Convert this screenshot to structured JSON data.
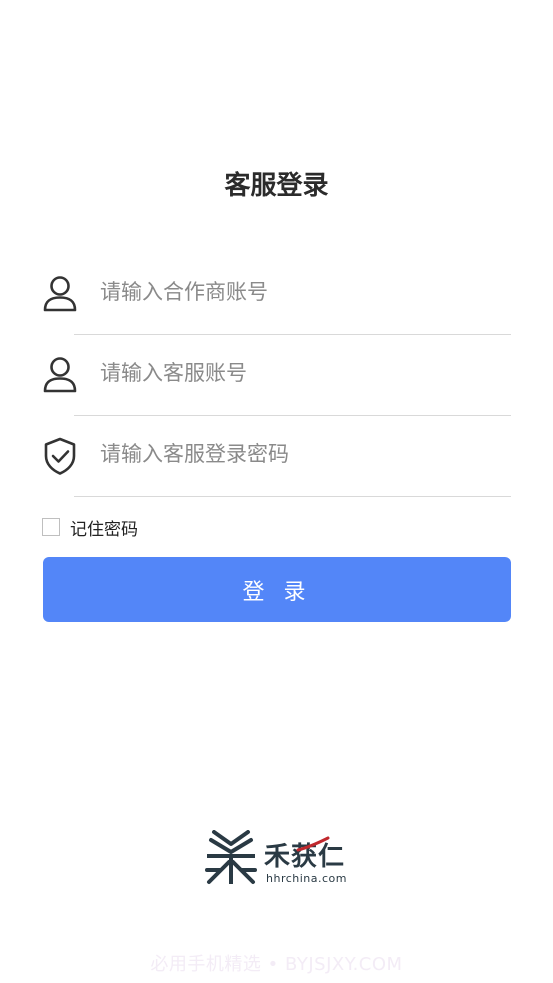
{
  "page": {
    "title": "客服登录"
  },
  "form": {
    "partner_account_placeholder": "请输入合作商账号",
    "service_account_placeholder": "请输入客服账号",
    "password_placeholder": "请输入客服登录密码",
    "remember_label": "记住密码",
    "remember_checked": false,
    "login_label": "登 录"
  },
  "icons": {
    "partner": "user-icon",
    "service": "user-icon",
    "password": "shield-check-icon"
  },
  "brand": {
    "name": "禾获仁",
    "domain": "hhrchina.com"
  },
  "watermark": "必用手机精选 • BYJSJXY.COM",
  "colors": {
    "primary": "#5386f8",
    "title": "#2b2b2b",
    "placeholder": "#8a8a8a",
    "divider": "#d9d9d9",
    "brand_dark": "#2a3a44",
    "brand_red": "#c0282d"
  }
}
